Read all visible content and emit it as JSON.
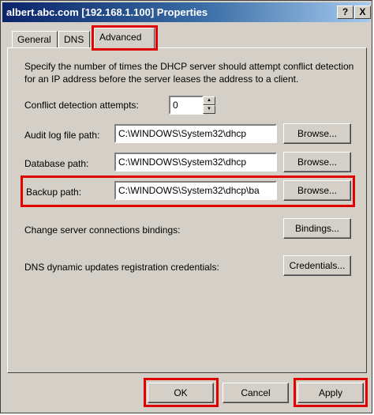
{
  "window": {
    "title": "albert.abc.com [192.168.1.100] Properties",
    "help_label": "?",
    "close_label": "X"
  },
  "tabs": [
    {
      "label": "General"
    },
    {
      "label": "DNS"
    },
    {
      "label": "Advanced"
    }
  ],
  "description": "Specify the number of times the DHCP server should attempt conflict detection for an IP address before the server leases the address to a client.",
  "conflict": {
    "label": "Conflict detection attempts:",
    "value": "0"
  },
  "audit": {
    "label": "Audit log file path:",
    "value": "C:\\WINDOWS\\System32\\dhcp",
    "button": "Browse..."
  },
  "database": {
    "label": "Database path:",
    "value": "C:\\WINDOWS\\System32\\dhcp",
    "button": "Browse..."
  },
  "backup": {
    "label": "Backup path:",
    "value": "C:\\WINDOWS\\System32\\dhcp\\ba",
    "button": "Browse..."
  },
  "bindings": {
    "label": "Change server connections bindings:",
    "button": "Bindings..."
  },
  "credentials": {
    "label": "DNS dynamic updates registration credentials:",
    "button": "Credentials..."
  },
  "footer": {
    "ok": "OK",
    "cancel": "Cancel",
    "apply": "Apply"
  },
  "colors": {
    "highlight": "#e00000",
    "dialog": "#d4d0c8",
    "titlebar": "#0a246a"
  }
}
